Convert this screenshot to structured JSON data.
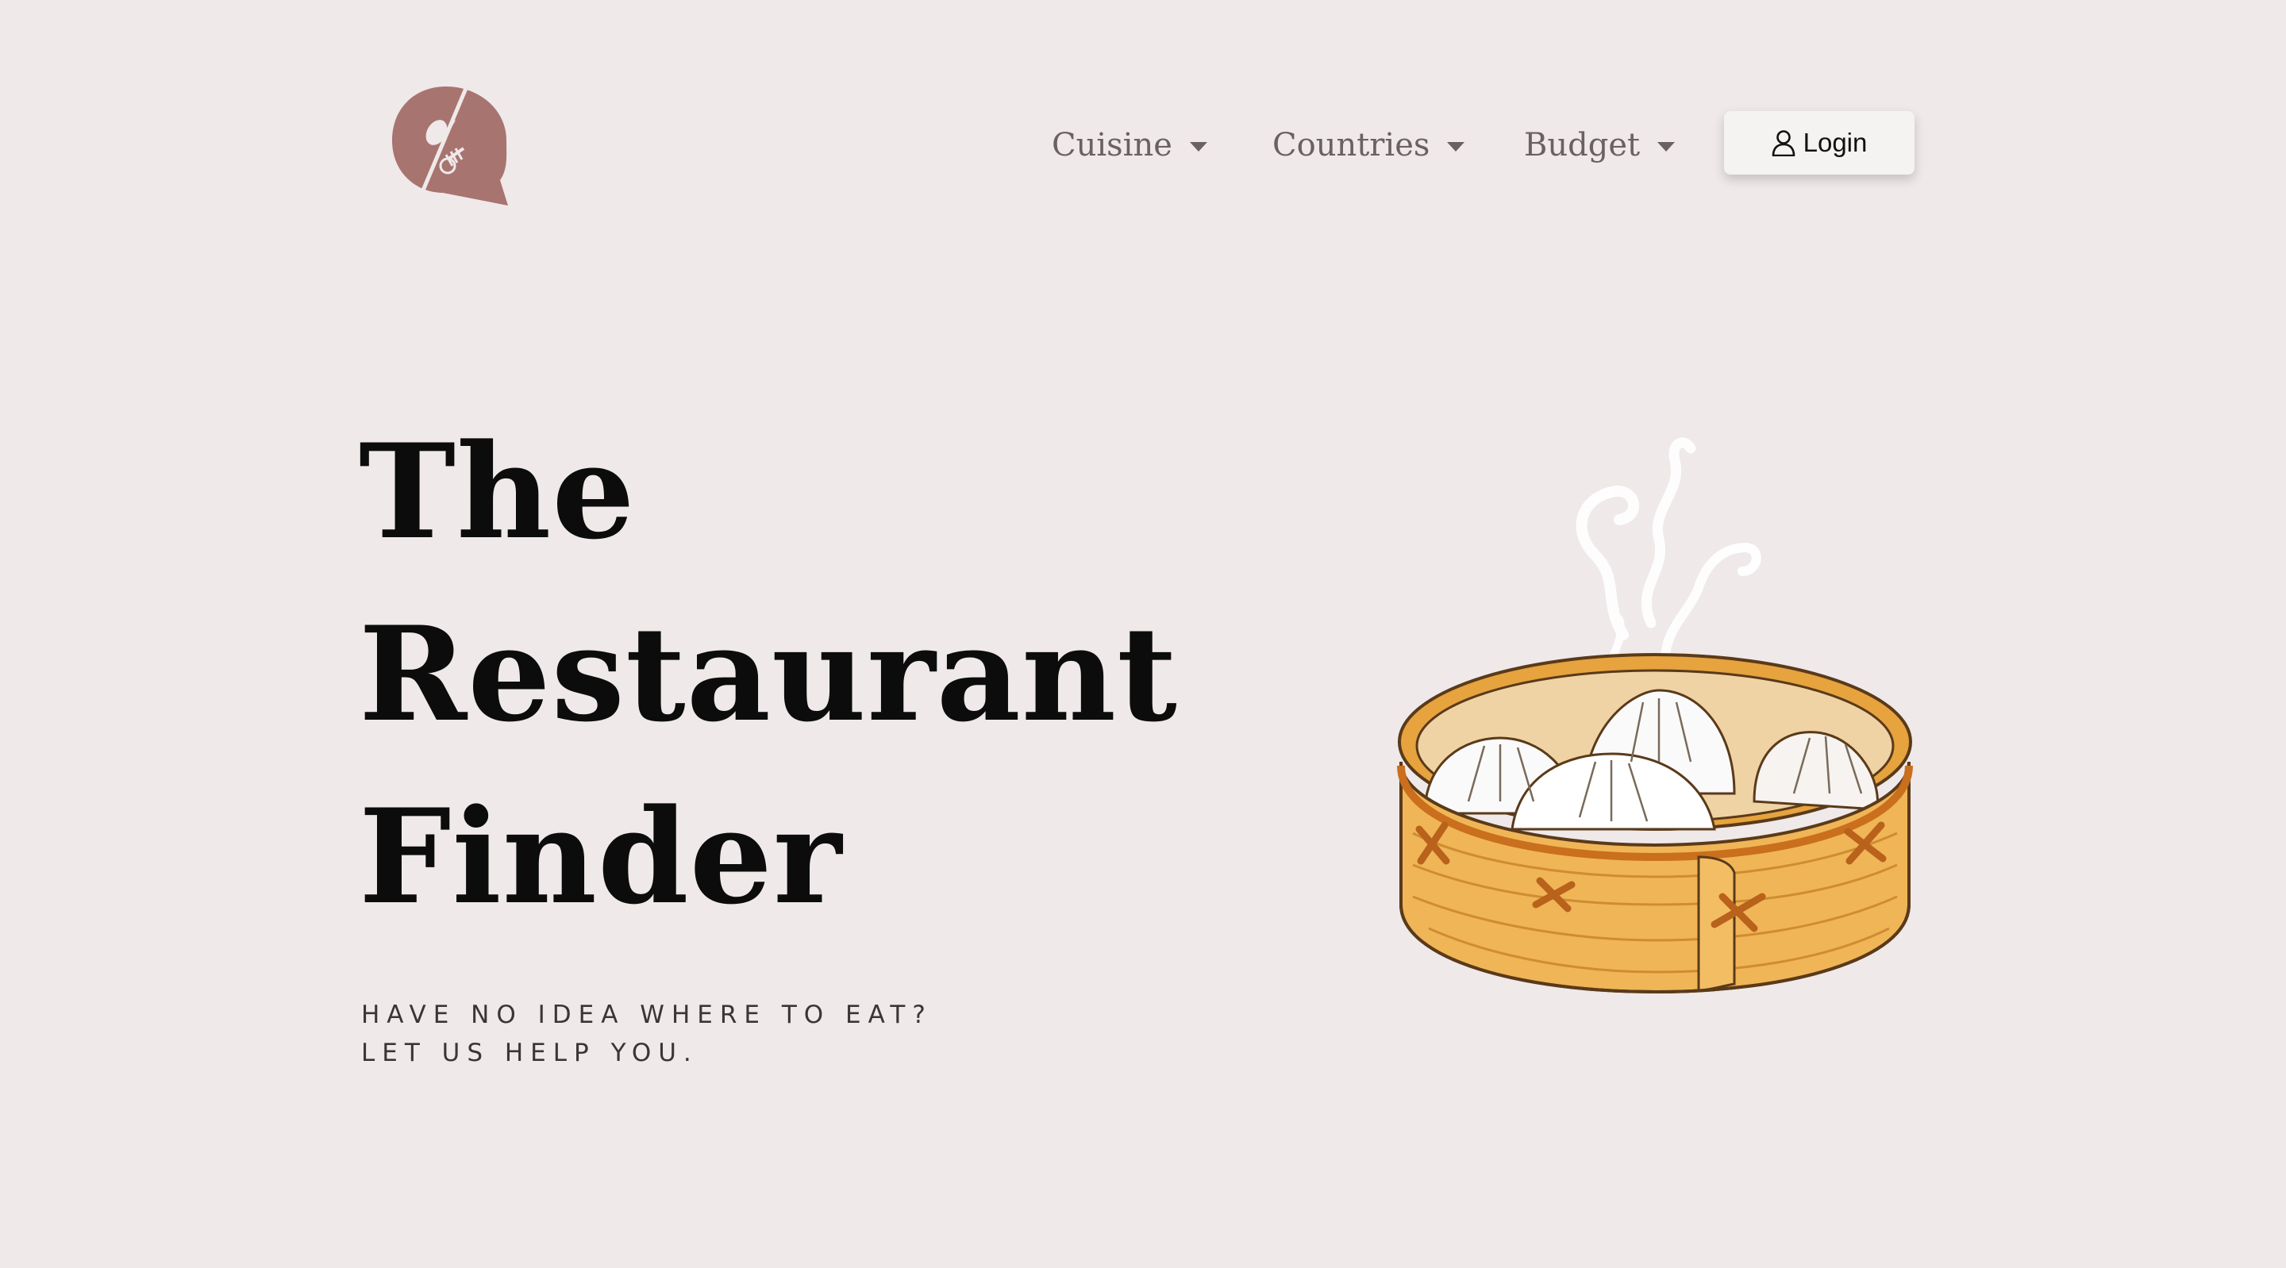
{
  "header": {
    "logo_icon": "speech-bubble-spoon-fork-icon",
    "nav": [
      {
        "label": "Cuisine"
      },
      {
        "label": "Countries"
      },
      {
        "label": "Budget"
      }
    ],
    "login_label": "Login",
    "login_icon": "user-icon"
  },
  "hero": {
    "title_lines": [
      "The",
      "Restaurant",
      "Finder"
    ],
    "tagline_lines": [
      "HAVE NO IDEA WHERE TO EAT?",
      "LET US HELP YOU."
    ],
    "illustration": "steamed-buns-in-bamboo-steamer"
  },
  "colors": {
    "background": "#efe9e9",
    "logo": "#a87470",
    "nav_text": "#6a6262",
    "title": "#0c0c0c"
  }
}
